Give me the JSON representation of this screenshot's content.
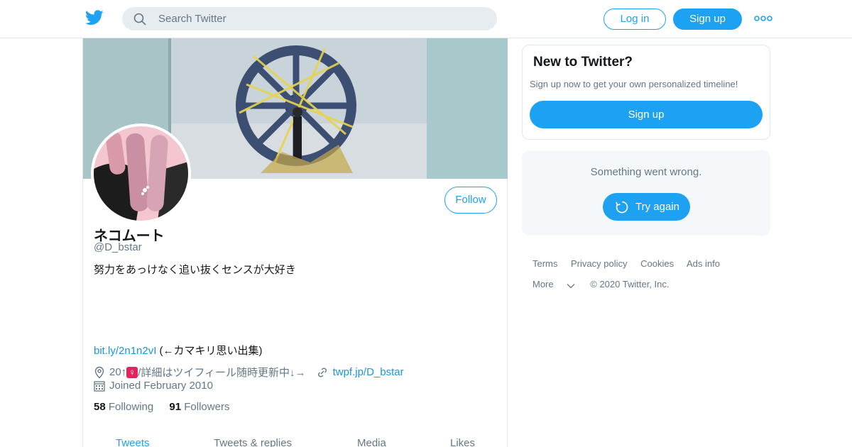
{
  "colors": {
    "accent": "#1da1f2",
    "link": "#1b95e0",
    "text": "#14171a",
    "muted": "#657786",
    "border": "#e1e8ed"
  },
  "topbar": {
    "logo_icon": "twitter-bird-icon",
    "search_placeholder": "Search Twitter",
    "login_label": "Log in",
    "signup_label": "Sign up",
    "more_icon": "more-dots-icon"
  },
  "profile": {
    "follow_label": "Follow",
    "display_name": "ネコムート",
    "handle": "@D_bstar",
    "bio_line1": "努力をあっけなく追い抜くセンスが大好き",
    "bio_link": "bit.ly/2n1n2vI",
    "bio_link_suffix": " (←カマキリ思い出集)",
    "location_prefix": "20↑",
    "location_emoji": "♀",
    "location_suffix": "/詳細はツイフィール随時更新中↓→",
    "website": "twpf.jp/D_bstar",
    "joined": "Joined February 2010",
    "following_count": "58",
    "following_label": "Following",
    "followers_count": "91",
    "followers_label": "Followers"
  },
  "tabs": [
    "Tweets",
    "Tweets & replies",
    "Media",
    "Likes"
  ],
  "sidebar": {
    "new_title": "New to Twitter?",
    "new_text": "Sign up now to get your own personalized timeline!",
    "signup_label": "Sign up",
    "error_text": "Something went wrong.",
    "retry_label": "Try again"
  },
  "footer": {
    "terms": "Terms",
    "privacy": "Privacy policy",
    "cookies": "Cookies",
    "ads": "Ads info",
    "more": "More",
    "copyright": "© 2020 Twitter, Inc."
  }
}
